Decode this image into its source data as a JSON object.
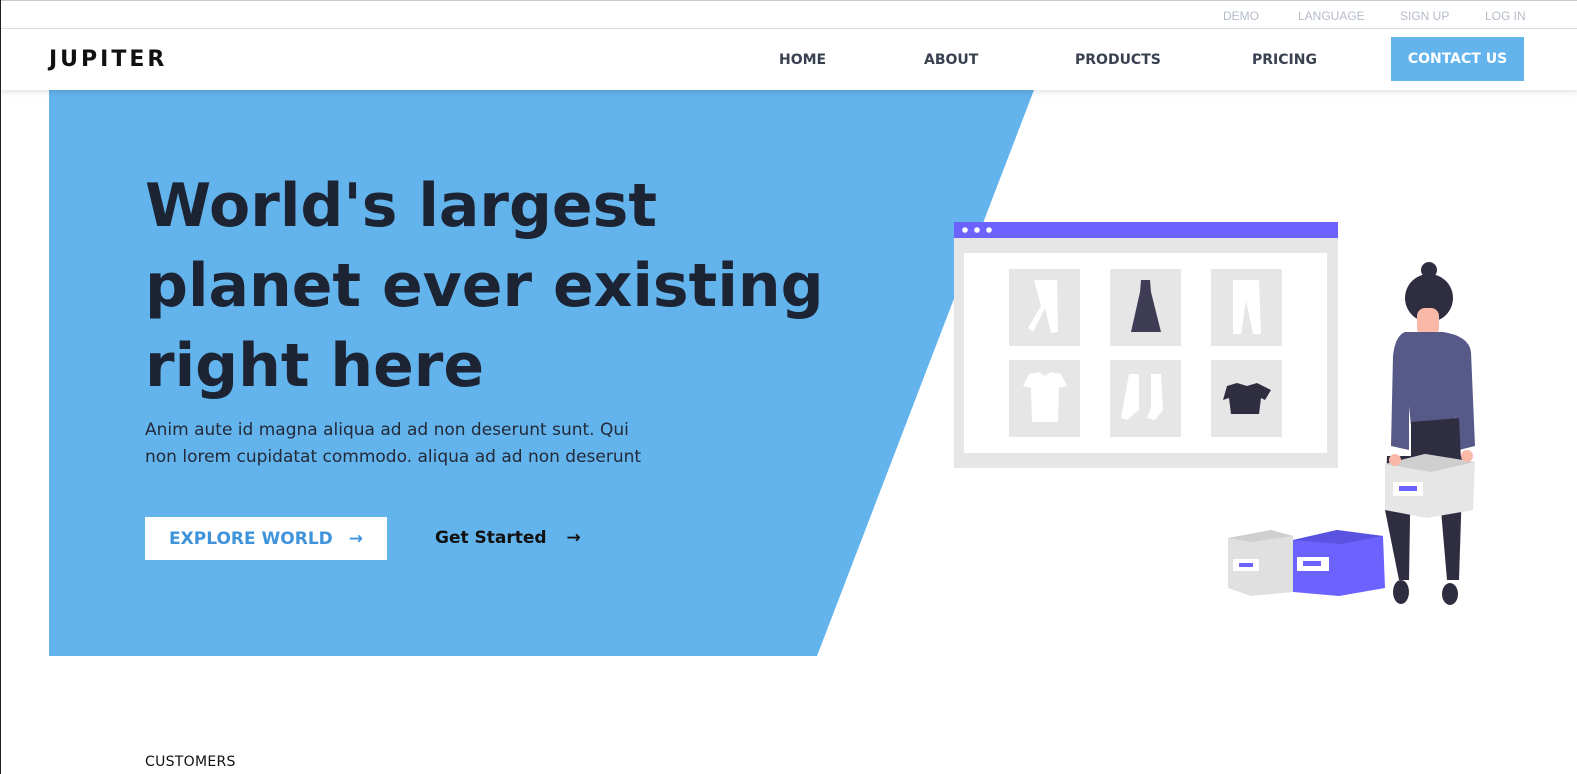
{
  "utility_nav": {
    "demo": "DEMO",
    "language": "LANGUAGE",
    "signup": "SIGN UP",
    "login": "LOG IN"
  },
  "header": {
    "logo": "JUPITER",
    "nav": {
      "home": "HOME",
      "about": "ABOUT",
      "products": "PRODUCTS",
      "pricing": "PRICING"
    },
    "contact_label": "CONTACT US"
  },
  "hero": {
    "title_line1": "World's largest",
    "title_line2": "planet ever existing",
    "title_line3": "right here",
    "description": "Anim aute id magna aliqua ad ad non deserunt sunt. Qui non lorem cupidatat commodo. aliqua ad ad non deserunt",
    "explore_label": "EXPLORE WORLD",
    "explore_arrow": "→",
    "get_started_label": "Get Started",
    "get_started_arrow": "→"
  },
  "customers": {
    "label": "CUSTOMERS"
  },
  "colors": {
    "hero_blue": "#63b3ec",
    "accent_purple": "#6c63ff",
    "text_dark": "#1c2333"
  },
  "icons": {
    "explore_arrow": "arrow-right-icon",
    "started_arrow": "arrow-right-icon"
  }
}
